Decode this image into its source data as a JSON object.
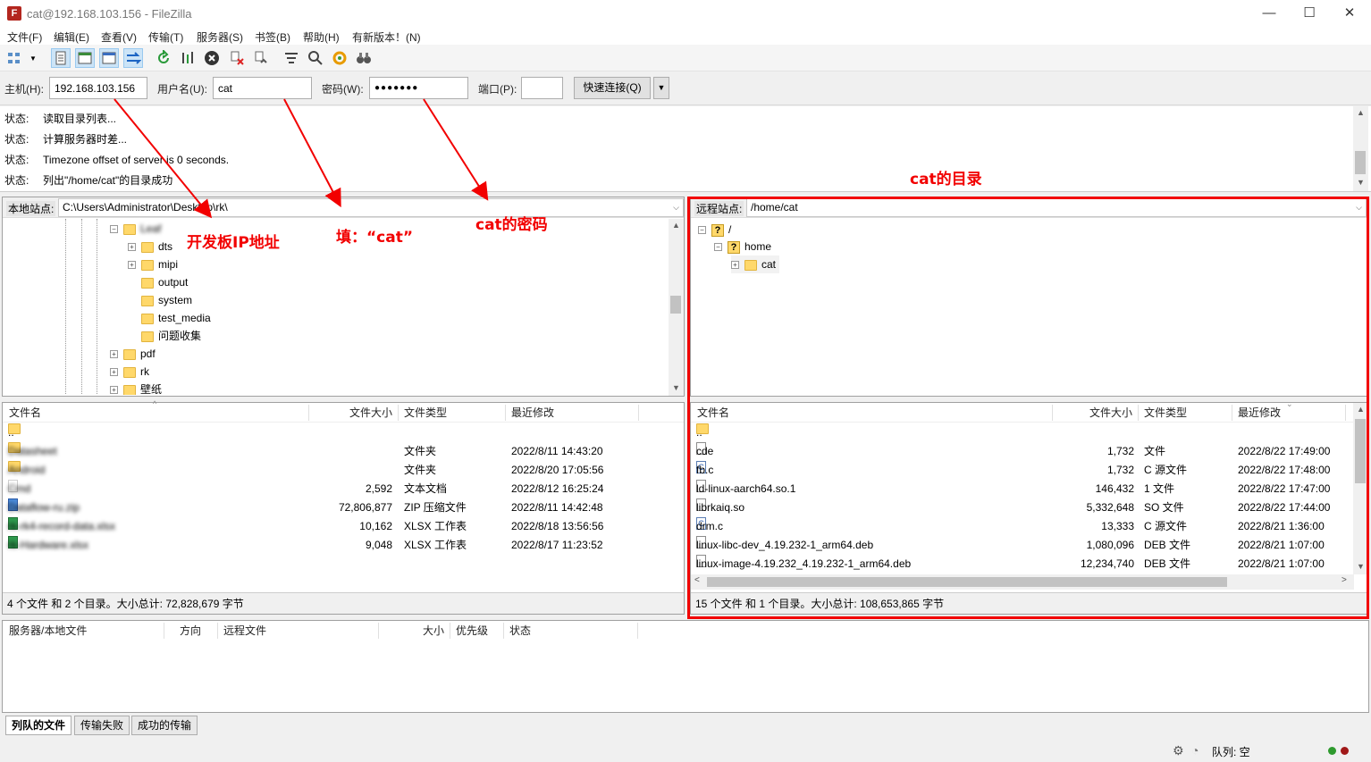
{
  "window": {
    "title": "cat@192.168.103.156 - FileZilla",
    "app_icon": "filezilla-icon"
  },
  "menu": [
    "文件(F)",
    "编辑(E)",
    "查看(V)",
    "传输(T)",
    "服务器(S)",
    "书签(B)",
    "帮助(H)",
    "有新版本！(N)"
  ],
  "quickconnect": {
    "host_label": "主机(H):",
    "host": "192.168.103.156",
    "user_label": "用户名(U):",
    "user": "cat",
    "pass_label": "密码(W):",
    "pass": "●●●●●●●",
    "port_label": "端口(P):",
    "port": "",
    "button": "快速连接(Q)"
  },
  "log": [
    {
      "k": "状态:",
      "v": "读取目录列表..."
    },
    {
      "k": "状态:",
      "v": "计算服务器时差..."
    },
    {
      "k": "状态:",
      "v": "Timezone offset of server is 0 seconds."
    },
    {
      "k": "状态:",
      "v": "列出\"/home/cat\"的目录成功"
    }
  ],
  "local": {
    "site_label": "本地站点:",
    "path": "C:\\Users\\Administrator\\Desktop\\rk\\",
    "tree": [
      {
        "name": "Leaf",
        "blur": true
      },
      {
        "name": "dts"
      },
      {
        "name": "mipi"
      },
      {
        "name": "output"
      },
      {
        "name": "system"
      },
      {
        "name": "test_media"
      },
      {
        "name": "问题收集"
      },
      {
        "name": "pdf"
      },
      {
        "name": "rk"
      },
      {
        "name": "壁纸"
      }
    ],
    "headers": {
      "name": "文件名",
      "size": "文件大小",
      "type": "文件类型",
      "modified": "最近修改"
    },
    "files": [
      {
        "name": "..",
        "size": "",
        "type": "",
        "modified": "",
        "icon": "folder"
      },
      {
        "name": "Datasheet",
        "size": "",
        "type": "文件夹",
        "modified": "2022/8/11 14:43:20",
        "icon": "folder",
        "blur": true
      },
      {
        "name": "Android",
        "size": "",
        "type": "文件夹",
        "modified": "2022/8/20 17:05:56",
        "icon": "folder",
        "blur": true
      },
      {
        "name": "Cmd",
        "size": "2,592",
        "type": "文本文档",
        "modified": "2022/8/12 16:25:24",
        "icon": "file",
        "blur": true
      },
      {
        "name": "Dataflow-ru.zip",
        "size": "72,806,877",
        "type": "ZIP 压缩文件",
        "modified": "2022/8/11 14:42:48",
        "icon": "zip",
        "blur": true
      },
      {
        "name": "rk-rk4-record-data.xlsx",
        "size": "10,162",
        "type": "XLSX 工作表",
        "modified": "2022/8/18 13:56:56",
        "icon": "xlsx",
        "blur": true
      },
      {
        "name": "rk-Hardware.xlsx",
        "size": "9,048",
        "type": "XLSX 工作表",
        "modified": "2022/8/17 11:23:52",
        "icon": "xlsx",
        "blur": true
      }
    ],
    "status": "4 个文件 和 2 个目录。大小总计: 72,828,679 字节"
  },
  "remote": {
    "site_label": "远程站点:",
    "path": "/home/cat",
    "tree": [
      {
        "name": "/"
      },
      {
        "name": "home"
      },
      {
        "name": "cat"
      }
    ],
    "headers": {
      "name": "文件名",
      "size": "文件大小",
      "type": "文件类型",
      "modified": "最近修改"
    },
    "files": [
      {
        "name": "..",
        "size": "",
        "type": "",
        "modified": "",
        "icon": "folder"
      },
      {
        "name": "cde",
        "size": "1,732",
        "type": "文件",
        "modified": "2022/8/22 17:49:00",
        "icon": "file"
      },
      {
        "name": "fb.c",
        "size": "1,732",
        "type": "C 源文件",
        "modified": "2022/8/22 17:48:00",
        "icon": "cfile"
      },
      {
        "name": "ld-linux-aarch64.so.1",
        "size": "146,432",
        "type": "1 文件",
        "modified": "2022/8/22 17:47:00",
        "icon": "file"
      },
      {
        "name": "librkaiq.so",
        "size": "5,332,648",
        "type": "SO 文件",
        "modified": "2022/8/22 17:44:00",
        "icon": "file"
      },
      {
        "name": "drm.c",
        "size": "13,333",
        "type": "C 源文件",
        "modified": "2022/8/21 1:36:00",
        "icon": "cfile"
      },
      {
        "name": "linux-libc-dev_4.19.232-1_arm64.deb",
        "size": "1,080,096",
        "type": "DEB 文件",
        "modified": "2022/8/21 1:07:00",
        "icon": "file"
      },
      {
        "name": "linux-image-4.19.232_4.19.232-1_arm64.deb",
        "size": "12,234,740",
        "type": "DEB 文件",
        "modified": "2022/8/21 1:07:00",
        "icon": "file"
      }
    ],
    "status": "15 个文件 和 1 个目录。大小总计: 108,653,865 字节"
  },
  "queue": {
    "headers": [
      "服务器/本地文件",
      "方向",
      "远程文件",
      "大小",
      "优先级",
      "状态"
    ],
    "tabs": [
      "列队的文件",
      "传输失败",
      "成功的传输"
    ],
    "status": "队列: 空"
  },
  "annotations": {
    "ip": "开发板IP地址",
    "user": "填：“cat”",
    "pass": "cat的密码",
    "dir": "cat的目录"
  },
  "colors": {
    "annotation": "#f20000",
    "highlight": "#cce4f7"
  }
}
